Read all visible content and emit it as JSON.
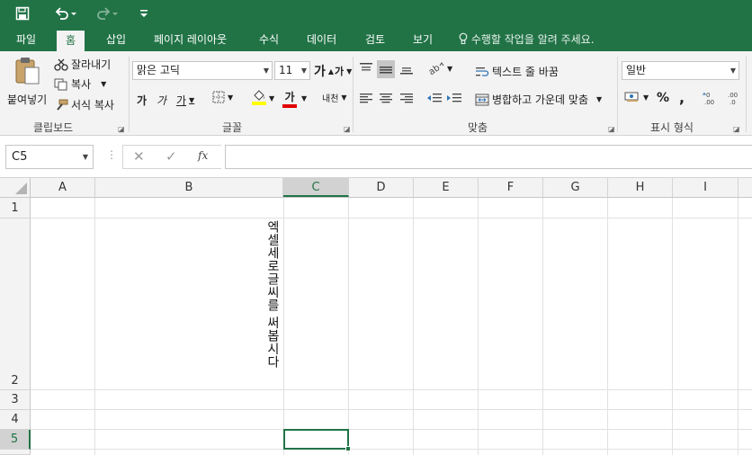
{
  "quick_access": {
    "save_icon": "save-icon",
    "undo_icon": "undo-icon",
    "redo_icon": "redo-icon",
    "customize_icon": "customize-icon"
  },
  "tabs": [
    {
      "label": "파일"
    },
    {
      "label": "홈"
    },
    {
      "label": "삽입"
    },
    {
      "label": "페이지 레이아웃"
    },
    {
      "label": "수식"
    },
    {
      "label": "데이터"
    },
    {
      "label": "검토"
    },
    {
      "label": "보기"
    }
  ],
  "tell_me": "수행할 작업을 알려 주세요.",
  "clipboard": {
    "paste_label": "붙여넣기",
    "cut_label": "잘라내기",
    "copy_label": "복사",
    "format_painter_label": "서식 복사",
    "group_label": "클립보드"
  },
  "font": {
    "name": "맑은 고딕",
    "size": "11",
    "grow_glyph": "가",
    "shrink_glyph": "가",
    "bold_glyph": "가",
    "italic_glyph": "가",
    "underline_glyph": "가",
    "font_color_glyph": "가",
    "phonetic_glyph": "내천",
    "group_label": "글꼴"
  },
  "alignment": {
    "wrap_text_label": "텍스트 줄 바꿈",
    "merge_center_label": "병합하고 가운데 맞춤",
    "group_label": "맞춤"
  },
  "number": {
    "format": "일반",
    "percent_glyph": "%",
    "comma_glyph": ",",
    "group_label": "표시 형식"
  },
  "formula_bar": {
    "name_box": "C5",
    "fx_label": "fx",
    "formula": ""
  },
  "columns": [
    "A",
    "B",
    "C",
    "D",
    "E",
    "F",
    "G",
    "H",
    "I"
  ],
  "rows": [
    "1",
    "2",
    "3",
    "4",
    "5"
  ],
  "cells": {
    "B2": "엑셀세로글씨를 써봅시다"
  },
  "selected_cell": "C5",
  "colors": {
    "accent": "#217346",
    "ribbon_bg": "#f3f3f3"
  }
}
